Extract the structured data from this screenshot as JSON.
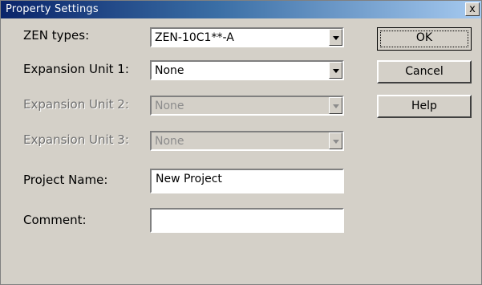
{
  "window": {
    "title": "Property Settings",
    "close_glyph": "x"
  },
  "fields": {
    "zen_types": {
      "label": "ZEN types:",
      "value": "ZEN-10C1**-A"
    },
    "expansion1": {
      "label": "Expansion Unit 1:",
      "value": "None"
    },
    "expansion2": {
      "label": "Expansion Unit 2:",
      "value": "None"
    },
    "expansion3": {
      "label": "Expansion Unit 3:",
      "value": "None"
    },
    "project_name": {
      "label": "Project Name:",
      "value": "New Project"
    },
    "comment": {
      "label": "Comment:",
      "value": ""
    }
  },
  "buttons": {
    "ok": "OK",
    "cancel": "Cancel",
    "help": "Help"
  },
  "colors": {
    "titlebar_start": "#0a246a",
    "titlebar_end": "#a6caf0",
    "face": "#d4d0c8"
  },
  "icons": {
    "close": "close-icon",
    "dropdown": "chevron-down-icon"
  }
}
